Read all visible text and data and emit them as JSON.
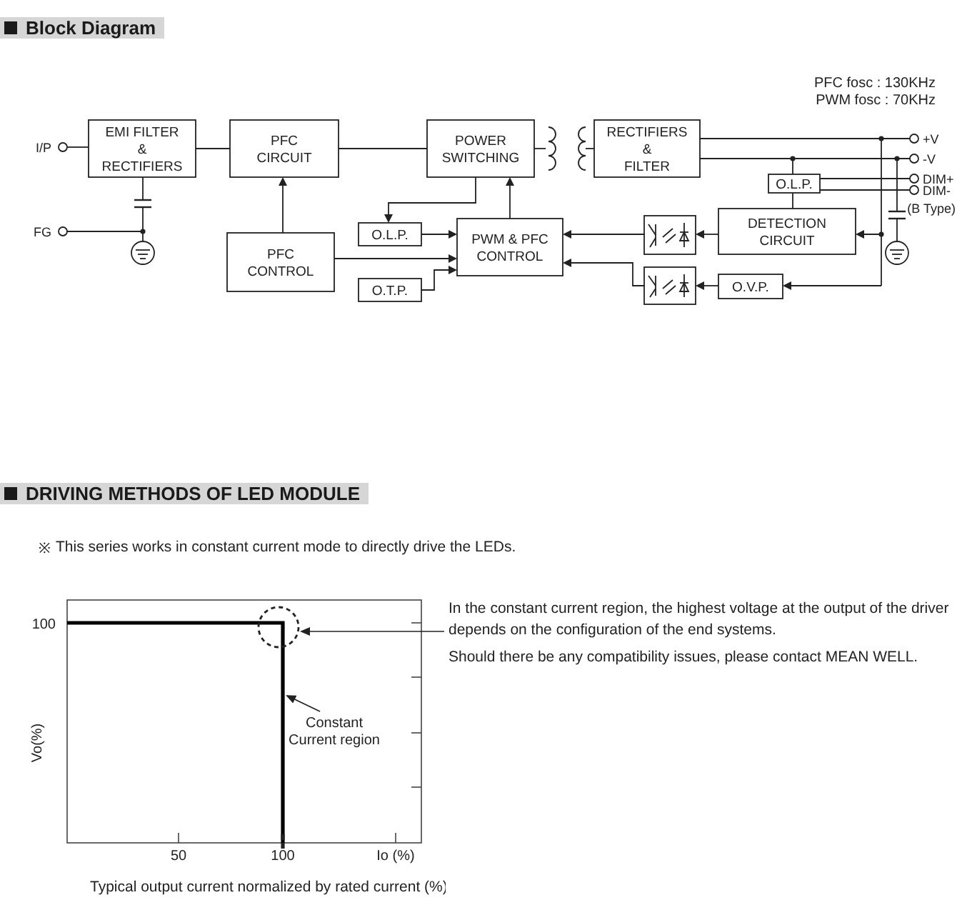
{
  "block_diagram": {
    "title": "Block Diagram",
    "notes": [
      "PFC fosc : 130KHz",
      "PWM fosc : 70KHz"
    ],
    "terminals": [
      {
        "label": "I/P"
      },
      {
        "label": "FG"
      },
      {
        "label": "+V"
      },
      {
        "label": "-V"
      },
      {
        "label": "DIM+"
      },
      {
        "label": "DIM-"
      }
    ],
    "type_note": "(B Type)",
    "blocks": [
      {
        "lines": [
          "EMI FILTER",
          "&",
          "RECTIFIERS"
        ]
      },
      {
        "lines": [
          "PFC",
          "CIRCUIT"
        ]
      },
      {
        "lines": [
          "POWER",
          "SWITCHING"
        ]
      },
      {
        "lines": [
          "RECTIFIERS",
          "&",
          "FILTER"
        ]
      },
      {
        "lines": [
          "O.L.P."
        ]
      },
      {
        "lines": [
          "PFC",
          "CONTROL"
        ]
      },
      {
        "lines": [
          "O.L.P."
        ]
      },
      {
        "lines": [
          "PWM & PFC",
          "CONTROL"
        ]
      },
      {
        "lines": [
          "DETECTION",
          "CIRCUIT"
        ]
      },
      {
        "lines": [
          "O.T.P."
        ]
      },
      {
        "lines": [
          "O.V.P."
        ]
      }
    ]
  },
  "driving_methods": {
    "title": "DRIVING METHODS OF LED MODULE",
    "note_mark": "※",
    "note": "This series works in constant current mode to directly drive the LEDs.",
    "plot": {
      "y_tick_labels": [
        "100"
      ],
      "y_axis_label": "Vo(%)",
      "callout": "Constant Current region",
      "x_tick_labels": [
        "50",
        "100",
        "Io (%)"
      ],
      "caption": "Typical output current normalized by rated current (%)"
    },
    "description": [
      "In the constant current region, the highest voltage at the output of the driver depends on the configuration of the end systems.",
      "Should there be any compatibility issues, please contact MEAN WELL."
    ]
  }
}
